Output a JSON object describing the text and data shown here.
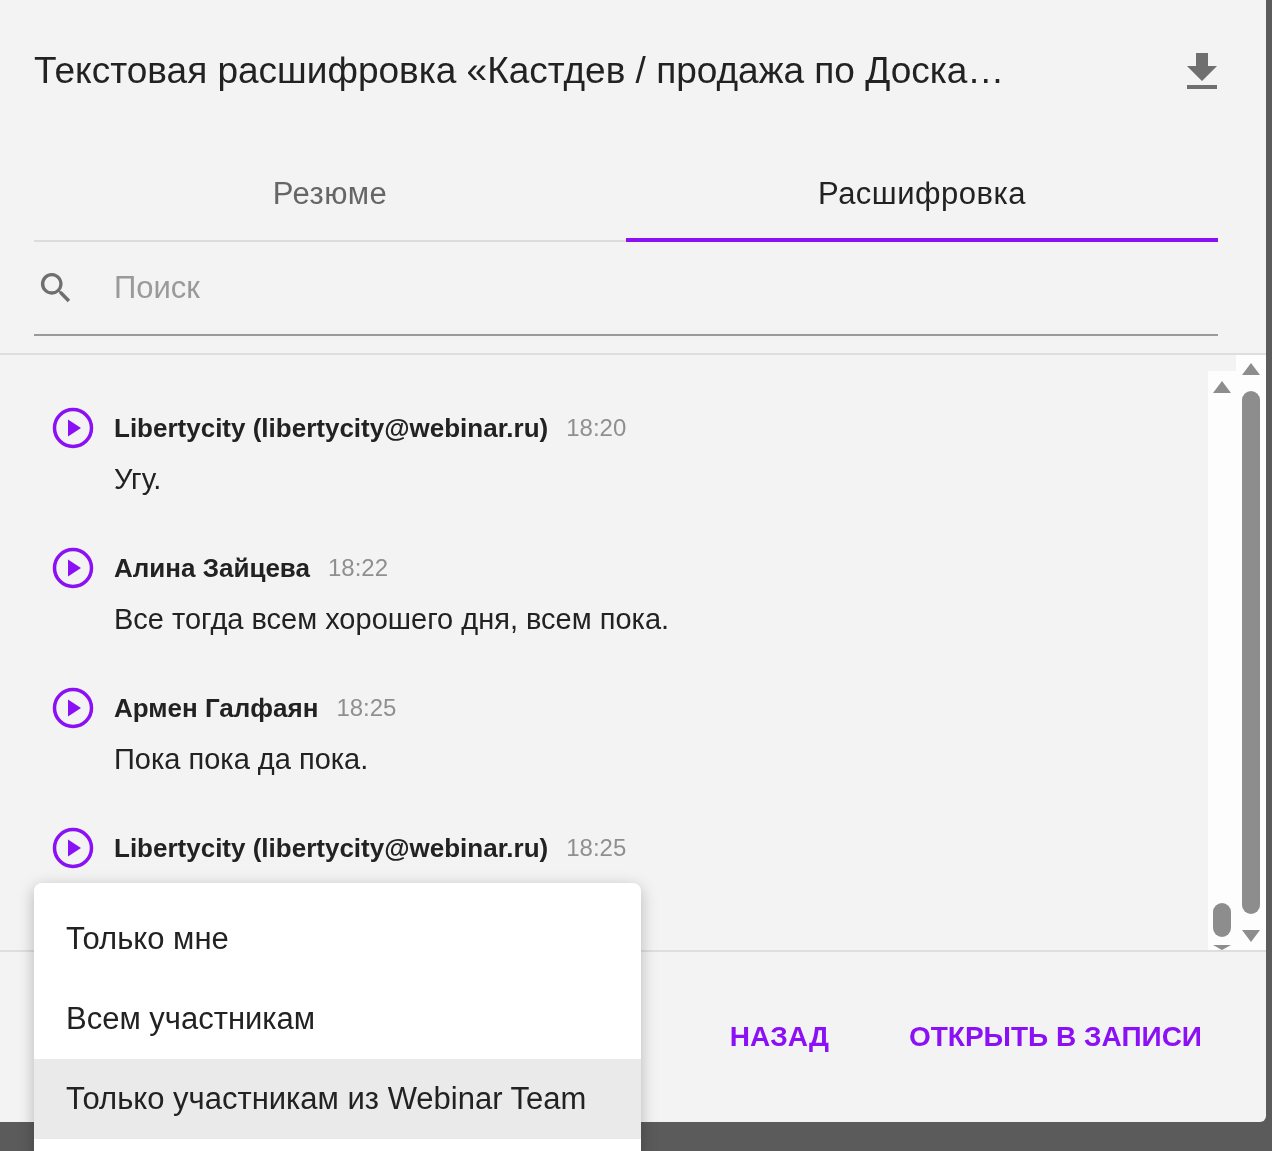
{
  "dialog": {
    "title": "Текстовая расшифровка «Кастдев / продажа по Доска…"
  },
  "tabs": [
    {
      "label": "Резюме",
      "selected": false
    },
    {
      "label": "Расшифровка",
      "selected": true
    }
  ],
  "search": {
    "placeholder": "Поиск"
  },
  "entries": [
    {
      "speaker": "Libertycity (libertycity@webinar.ru)",
      "time": "18:20",
      "text": "Угу."
    },
    {
      "speaker": "Алина Зайцева",
      "time": "18:22",
      "text": "Все тогда всем хорошего дня, всем пока."
    },
    {
      "speaker": "Армен Галфаян",
      "time": "18:25",
      "text": "Пока пока да пока."
    },
    {
      "speaker": "Libertycity (libertycity@webinar.ru)",
      "time": "18:25"
    }
  ],
  "footer_buttons": [
    "НАЗАД",
    "ОТКРЫТЬ В ЗАПИСИ"
  ],
  "menu": [
    {
      "label": "Только мне",
      "selected": false
    },
    {
      "label": "Всем участникам",
      "selected": false
    },
    {
      "label": "Только участникам из Webinar Team",
      "selected": true
    }
  ]
}
